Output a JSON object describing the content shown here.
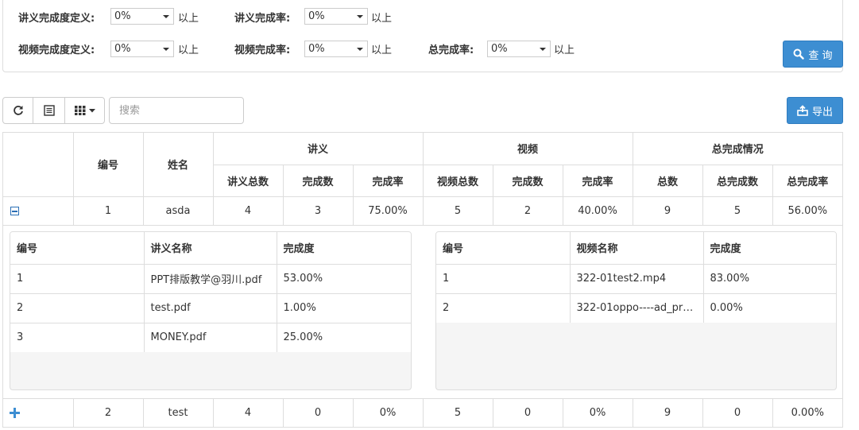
{
  "filters": {
    "row1": [
      {
        "label": "讲义完成度定义:",
        "value": "0%",
        "suffix": "以上"
      },
      {
        "label": "讲义完成率:",
        "value": "0%",
        "suffix": "以上"
      }
    ],
    "row2": [
      {
        "label": "视频完成度定义:",
        "value": "0%",
        "suffix": "以上"
      },
      {
        "label": "视频完成率:",
        "value": "0%",
        "suffix": "以上"
      },
      {
        "label": "总完成率:",
        "value": "0%",
        "suffix": "以上"
      }
    ],
    "query_label": "查 询"
  },
  "toolbar": {
    "refresh_icon": "refresh-icon",
    "list_icon": "list-icon",
    "columns_icon": "columns-icon",
    "search_placeholder": "搜索",
    "export_label": "导出"
  },
  "table": {
    "groups": [
      "讲义",
      "视频",
      "总完成情况"
    ],
    "col_no": "编号",
    "col_name": "姓名",
    "subheaders": [
      "讲义总数",
      "完成数",
      "完成率",
      "视频总数",
      "完成数",
      "完成率",
      "总数",
      "总完成数",
      "总完成率"
    ],
    "rows": [
      {
        "no": "1",
        "name": "asda",
        "vals": [
          "4",
          "3",
          "75.00%",
          "5",
          "2",
          "40.00%",
          "9",
          "5",
          "56.00%"
        ],
        "expanded": true
      },
      {
        "no": "2",
        "name": "test",
        "vals": [
          "4",
          "0",
          "0%",
          "5",
          "0",
          "0%",
          "9",
          "0",
          "0.00%"
        ],
        "expanded": false
      }
    ]
  },
  "detail": {
    "lecture": {
      "headers": [
        "编号",
        "讲义名称",
        "完成度"
      ],
      "rows": [
        [
          "1",
          "PPT排版教学@羽川.pdf",
          "53.00%"
        ],
        [
          "2",
          "test.pdf",
          "1.00%"
        ],
        [
          "3",
          "MONEY.pdf",
          "25.00%"
        ]
      ]
    },
    "video": {
      "headers": [
        "编号",
        "视频名称",
        "完成度"
      ],
      "rows": [
        [
          "1",
          "322-01test2.mp4",
          "83.00%"
        ],
        [
          "2",
          "322-01oppo----ad_pr…",
          "0.00%"
        ]
      ]
    }
  }
}
